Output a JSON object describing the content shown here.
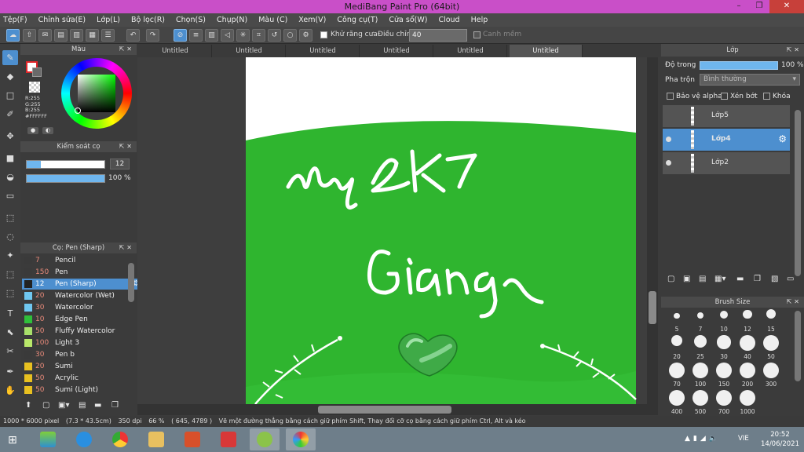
{
  "app": {
    "title": "MediBang Paint Pro (64bit)"
  },
  "window_buttons": {
    "minimize": "–",
    "maximize": "❐",
    "close": "✕"
  },
  "menu": [
    "Tệp(F)",
    "Chỉnh sửa(E)",
    "Lớp(L)",
    "Bộ lọc(R)",
    "Chọn(S)",
    "Chụp(N)",
    "Màu (C)",
    "Xem(V)",
    "Công cụ(T)",
    "Cửa sổ(W)",
    "Cloud",
    "Help"
  ],
  "toolbar": {
    "antialias_label": "Khử răng cưa",
    "adjust_label": "Điều chỉnh",
    "adjust_value": "40",
    "smooth_label": "Canh mềm"
  },
  "color_panel": {
    "title": "Màu",
    "rgb_r": "R:255",
    "rgb_g": "G:255",
    "rgb_b": "B:255",
    "hex": "#FFFFFF"
  },
  "brush_control": {
    "title": "Kiểm soát cọ",
    "size": "12",
    "opacity": "100 %",
    "size_fraction": 0.18,
    "opacity_fraction": 1.0
  },
  "brush_panel": {
    "title": "Cọ: Pen (Sharp)",
    "items": [
      {
        "num": "7",
        "name": "Pencil",
        "color": "#3a3a3a"
      },
      {
        "num": "150",
        "name": "Pen",
        "color": "#3a3a3a"
      },
      {
        "num": "12",
        "name": "Pen (Sharp)",
        "color": "#222222"
      },
      {
        "num": "20",
        "name": "Watercolor (Wet)",
        "color": "#6fc7f0"
      },
      {
        "num": "30",
        "name": "Watercolor",
        "color": "#6fc7f0"
      },
      {
        "num": "10",
        "name": "Edge Pen",
        "color": "#2fbf3a"
      },
      {
        "num": "50",
        "name": "Fluffy Watercolor",
        "color": "#a8e06a"
      },
      {
        "num": "100",
        "name": "Light 3",
        "color": "#b9e86a"
      },
      {
        "num": "30",
        "name": "Pen b",
        "color": "#3a3a3a"
      },
      {
        "num": "20",
        "name": "Sumi",
        "color": "#e8c020"
      },
      {
        "num": "50",
        "name": "Acrylic",
        "color": "#e8c020"
      },
      {
        "num": "50",
        "name": "Sumi (Light)",
        "color": "#e8c020"
      }
    ]
  },
  "tabs": [
    "Untitled",
    "Untitled",
    "Untitled",
    "Untitled",
    "Untitled",
    "Untitled"
  ],
  "layer_panel": {
    "title": "Lớp",
    "opacity_label": "Độ trong",
    "opacity_value": "100 %",
    "blend_label": "Pha trộn",
    "blend_value": "Bình thường",
    "protect_alpha": "Bảo vệ alpha",
    "clipping": "Xén bớt",
    "lock": "Khóa",
    "layers": [
      "Lớp5",
      "Lớp4",
      "Lớp2"
    ]
  },
  "brush_size": {
    "title": "Brush Size",
    "sizes": [
      "5",
      "7",
      "10",
      "12",
      "15",
      "20",
      "25",
      "30",
      "40",
      "50",
      "70",
      "100",
      "150",
      "200",
      "300",
      "400",
      "500",
      "700",
      "1000"
    ]
  },
  "status": {
    "dimensions": "1000 * 6000 pixel",
    "size_cm": "(7.3 * 43.5cm)",
    "dpi": "350 dpi",
    "zoom": "66 %",
    "cursor": "( 645, 4789 )",
    "hint": "Vẽ một đường thẳng bằng cách giữ phím Shift, Thay đổi cỡ cọ bằng cách giữ phím Ctrl, Alt và kéo"
  },
  "taskbar": {
    "lang": "VIE",
    "time": "20:52",
    "date": "14/06/2021"
  },
  "colors": {
    "accent": "#4d8fcf",
    "canvas_green": "#2fb52f",
    "title_bar": "#c94fc8"
  }
}
